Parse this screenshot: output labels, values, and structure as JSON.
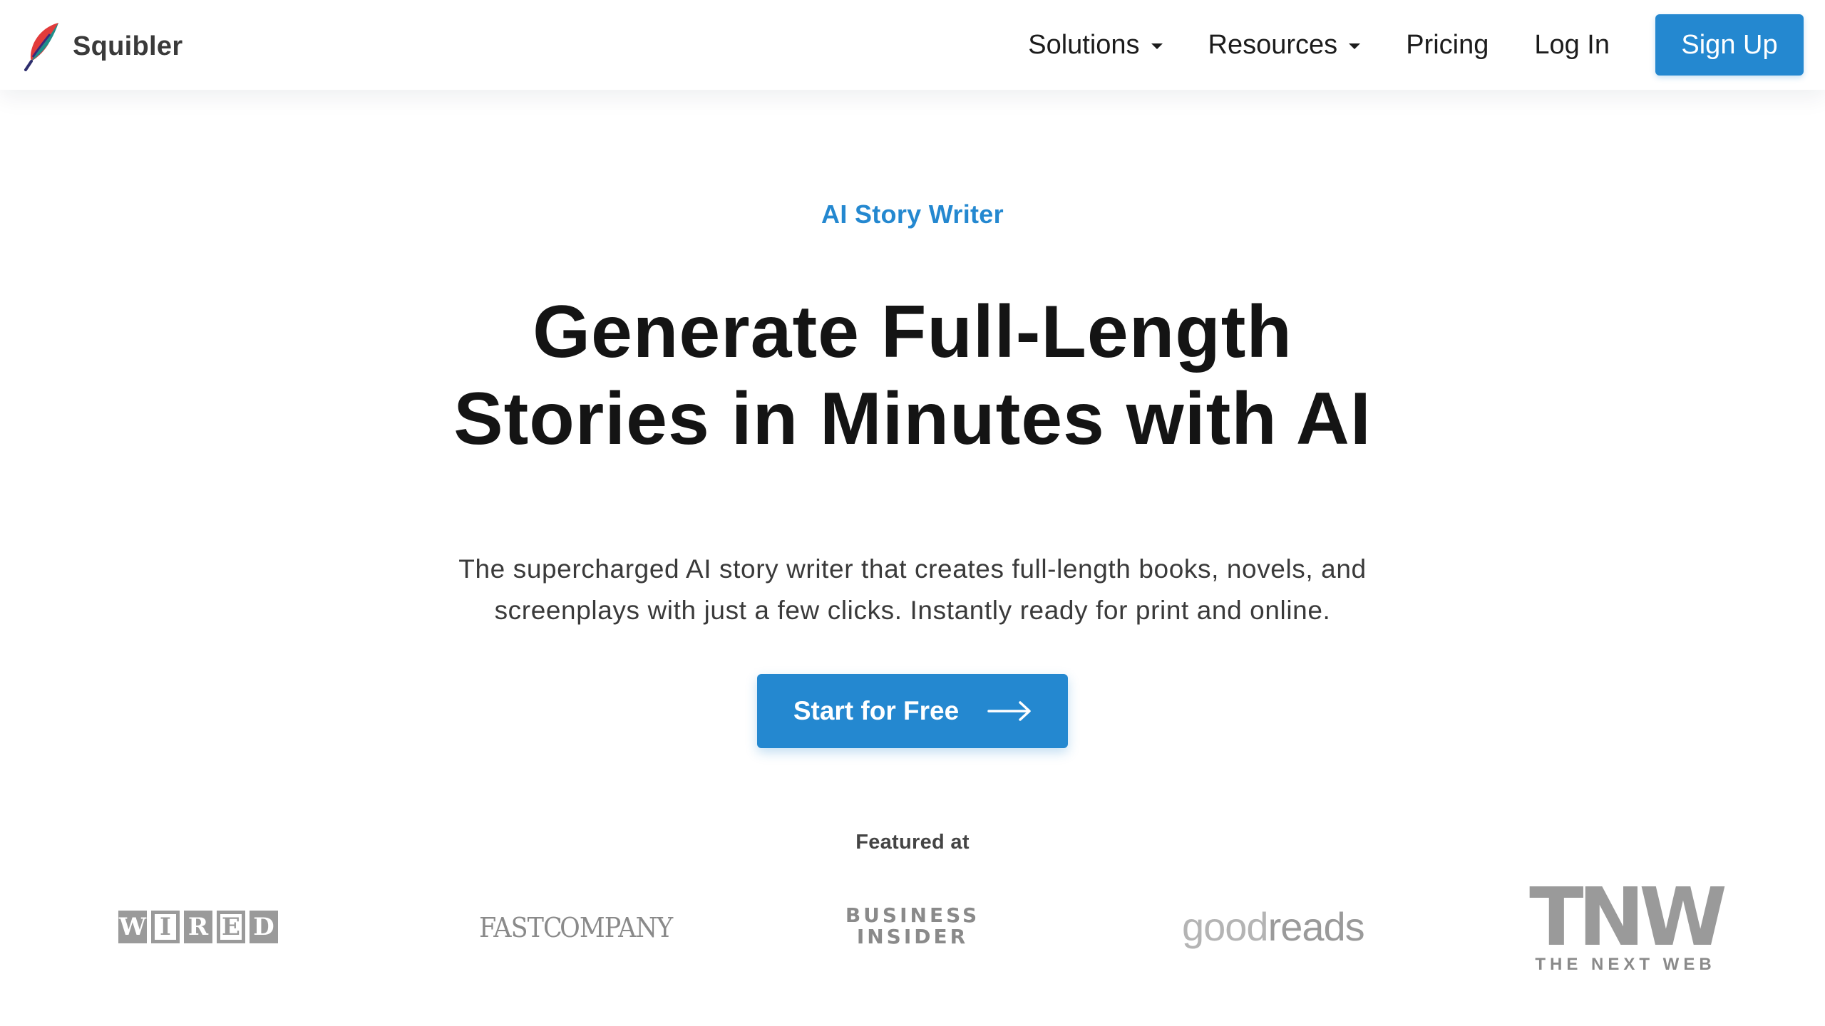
{
  "brand": {
    "name": "Squibler",
    "logo_icon": "feather-quill-icon"
  },
  "nav": {
    "items": [
      {
        "label": "Solutions",
        "has_dropdown": true
      },
      {
        "label": "Resources",
        "has_dropdown": true
      },
      {
        "label": "Pricing",
        "has_dropdown": false
      },
      {
        "label": "Log In",
        "has_dropdown": false
      }
    ],
    "signup_label": "Sign Up"
  },
  "hero": {
    "eyebrow": "AI Story Writer",
    "headline_line1": "Generate Full-Length",
    "headline_line2": "Stories in Minutes with AI",
    "subtext_line1": "The supercharged AI story writer that creates full-length books, novels, and",
    "subtext_line2": "screenplays with just a few clicks. Instantly ready for print and online.",
    "cta_label": "Start for Free",
    "cta_icon": "arrow-right-icon"
  },
  "featured": {
    "label": "Featured at",
    "logos": [
      "WIRED",
      "FAST COMPANY",
      "BUSINESS INSIDER",
      "goodreads",
      "TNW THE NEXT WEB"
    ],
    "tnw_tagline": "THE NEXT WEB"
  },
  "colors": {
    "accent": "#2488d0",
    "heading": "#141414",
    "body_text": "#3a3a3a",
    "logo_gray": "#9a9a9a"
  }
}
